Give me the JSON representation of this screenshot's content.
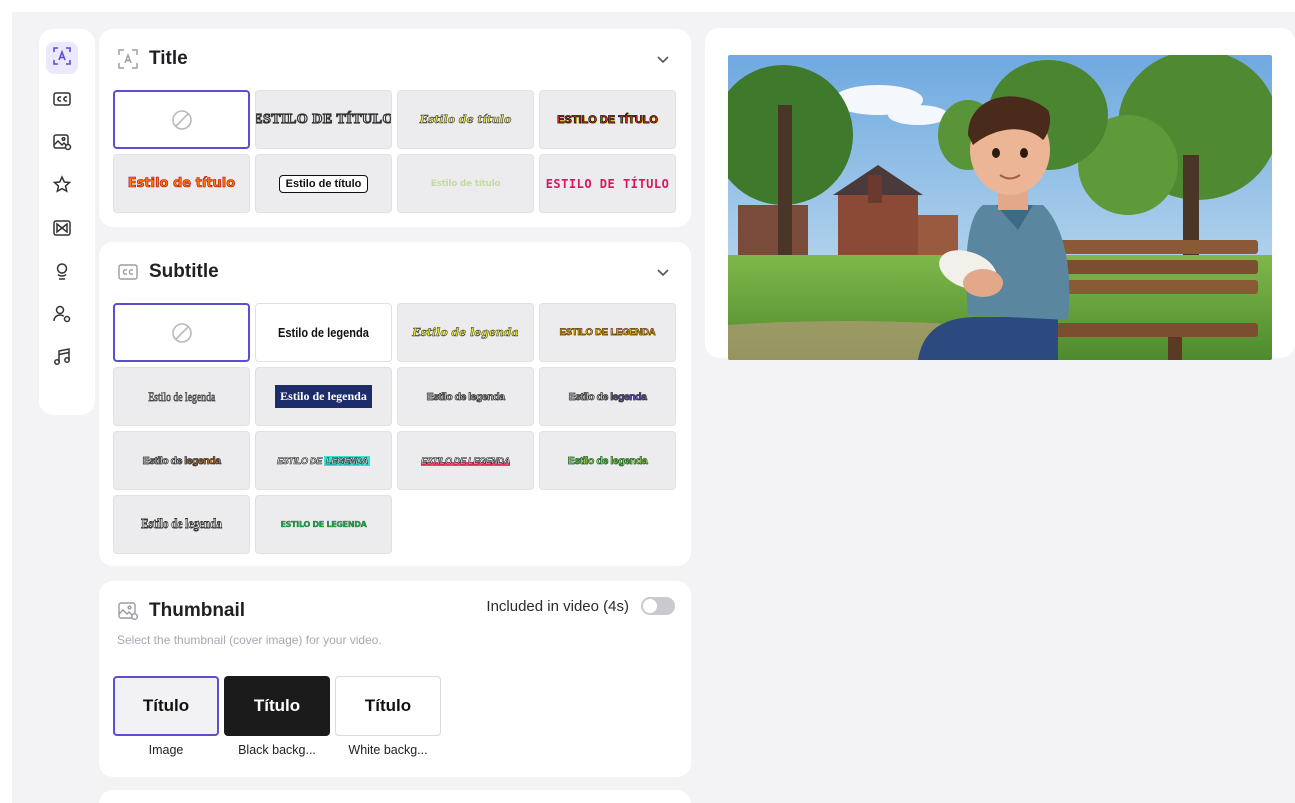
{
  "sidebar": {
    "icons": [
      "title-icon",
      "subtitle-icon",
      "thumbnail-icon",
      "sticker-icon",
      "transition-icon",
      "voice-icon",
      "avatar-icon",
      "music-icon"
    ]
  },
  "title_section": {
    "title": "Title",
    "styles": [
      {
        "label": "",
        "kind": "none"
      },
      {
        "label": "ESTILO DE TÍTULO"
      },
      {
        "label": "Estilo de título"
      },
      {
        "label": "ESTILO DE TÍTULO"
      },
      {
        "label": "Estilo de título"
      },
      {
        "label": "Estilo de título"
      },
      {
        "label": "Estilo de título"
      },
      {
        "label": "ESTILO DE TÍTULO"
      }
    ]
  },
  "subtitle_section": {
    "title": "Subtitle",
    "styles": [
      {
        "label": "",
        "kind": "none"
      },
      {
        "label": "Estilo de legenda"
      },
      {
        "label": "Estilo de legenda"
      },
      {
        "label": "ESTILO DE LEGENDA"
      },
      {
        "label": "Estilo de legenda"
      },
      {
        "label": "Estilo de legenda"
      },
      {
        "label": "Estilo de legenda"
      },
      {
        "label_a": "Estilo de ",
        "label_b": "legenda"
      },
      {
        "label_a": "Estilo de ",
        "label_b": "legenda"
      },
      {
        "label_a": "ESTILO DE ",
        "label_b": "LEGENDA"
      },
      {
        "label": "ESTILO DE LEGENDA"
      },
      {
        "label": "Estilo de legenda"
      },
      {
        "label": "Estilo de legenda"
      },
      {
        "label": "ESTILO DE LEGENDA"
      }
    ]
  },
  "thumbnail_section": {
    "title": "Thumbnail",
    "toggle_label": "Included in video (4s)",
    "toggle_on": false,
    "description": "Select the thumbnail (cover image) for your video.",
    "options": [
      {
        "text": "Título",
        "caption": "Image"
      },
      {
        "text": "Título",
        "caption": "Black backg..."
      },
      {
        "text": "Título",
        "caption": "White backg..."
      }
    ]
  },
  "colors": {
    "accent": "#5b4ecf",
    "accent_bg": "#ece9ff",
    "panel_bg": "#f3f3f5"
  }
}
